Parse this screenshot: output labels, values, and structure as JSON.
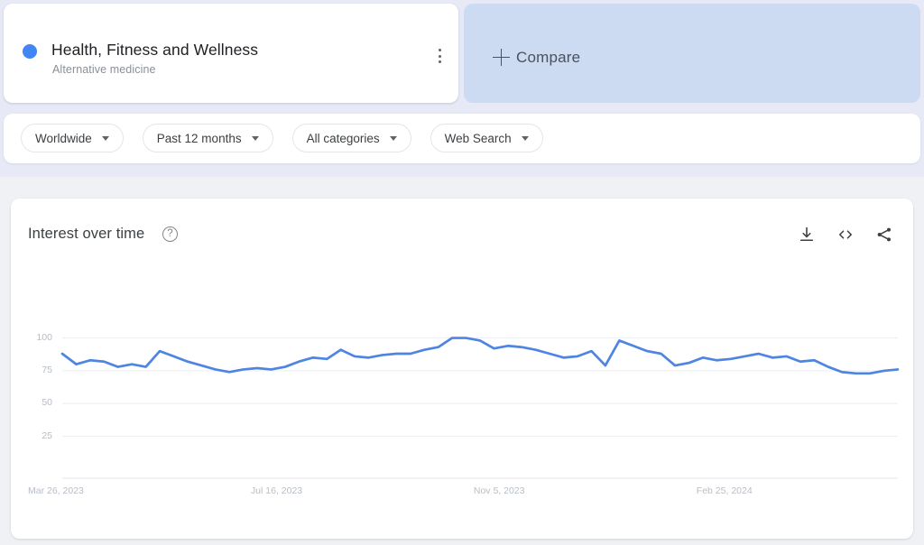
{
  "search_term": {
    "title": "Health, Fitness and Wellness",
    "subtitle": "Alternative medicine",
    "dot_color": "#4285f4",
    "menu_icon": "more-vert-icon"
  },
  "compare": {
    "label": "Compare",
    "plus_icon": "plus-icon"
  },
  "filters": [
    {
      "label": "Worldwide"
    },
    {
      "label": "Past 12 months"
    },
    {
      "label": "All categories"
    },
    {
      "label": "Web Search"
    }
  ],
  "chart_panel": {
    "title": "Interest over time",
    "help_icon": "help-circle-icon",
    "help_glyph": "?",
    "actions": [
      {
        "name": "download-icon"
      },
      {
        "name": "embed-code-icon"
      },
      {
        "name": "share-icon"
      }
    ]
  },
  "chart_data": {
    "type": "line",
    "title": "Interest over time",
    "xlabel": "",
    "ylabel": "",
    "ylim": [
      0,
      110
    ],
    "yticks": [
      25,
      50,
      75,
      100
    ],
    "ytick_labels": [
      "25",
      "50",
      "75",
      "100"
    ],
    "grid": true,
    "legend": false,
    "line_color": "#4e84e2",
    "xtick_labels": [
      "Mar 26, 2023",
      "Jul 16, 2023",
      "Nov 5, 2023",
      "Feb 25, 2024"
    ],
    "xtick_index": [
      0,
      16,
      32,
      48
    ],
    "series": [
      {
        "name": "Health, Fitness and Wellness",
        "values": [
          88,
          80,
          83,
          82,
          78,
          80,
          78,
          90,
          86,
          82,
          79,
          76,
          74,
          76,
          77,
          76,
          78,
          82,
          85,
          84,
          91,
          86,
          85,
          87,
          88,
          88,
          91,
          93,
          100,
          100,
          98,
          92,
          94,
          93,
          91,
          88,
          85,
          86,
          90,
          79,
          98,
          94,
          90,
          88,
          79,
          81,
          85,
          83,
          84,
          86,
          88,
          85,
          86,
          82,
          83,
          78,
          74,
          73,
          73,
          75,
          76
        ]
      }
    ]
  }
}
